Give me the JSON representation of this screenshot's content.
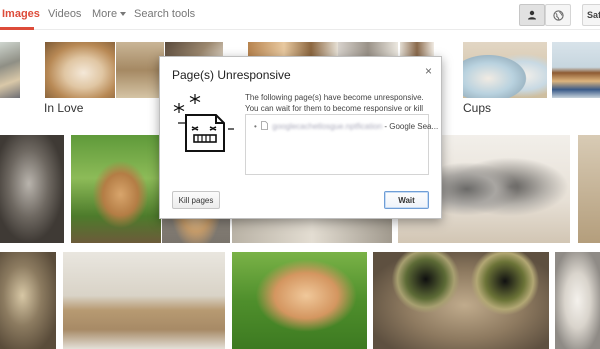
{
  "nav": {
    "tabs": [
      "Images",
      "Videos",
      "More",
      "Search tools"
    ],
    "safe_label": "Safe",
    "accent": "#dd4b39"
  },
  "categories": {
    "in_love": "In Love",
    "cups": "Cups"
  },
  "dialog": {
    "title": "Page(s) Unresponsive",
    "close_glyph": "×",
    "message": "The following page(s) have become unresponsive. You can wait for them to become responsive or kill them.",
    "page_url_blurred": "googlecachetlosgue.nptfication",
    "page_title": " - Google Sea...",
    "kill_button": "Kill pages",
    "wait_button": "Wait"
  },
  "icons": [
    "person-icon",
    "globe-icon",
    "frozen-page-icon",
    "snowflake-icon",
    "page-bullet-icon"
  ]
}
